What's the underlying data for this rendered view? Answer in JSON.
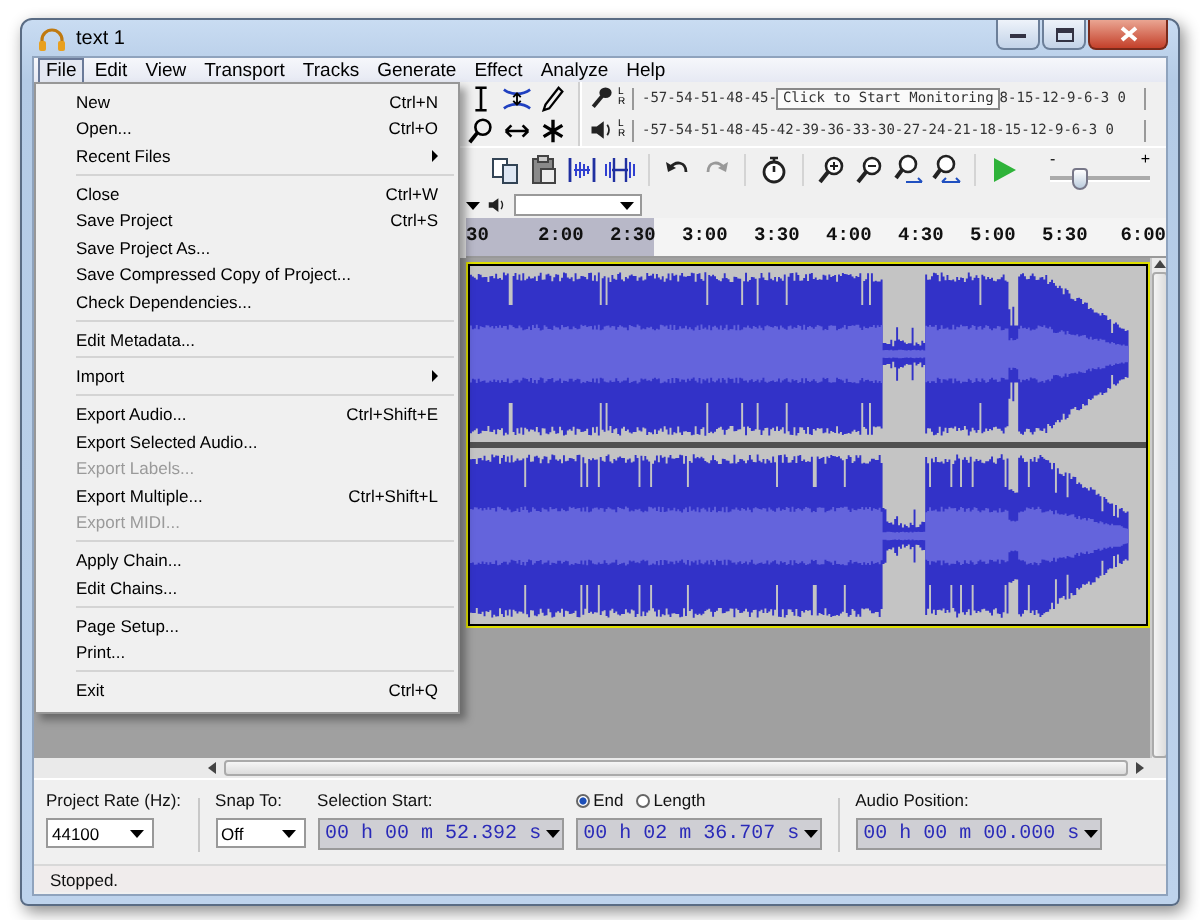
{
  "window": {
    "title": "text 1"
  },
  "menu_bar": [
    {
      "label": "File",
      "selected": true
    },
    {
      "label": "Edit",
      "selected": false
    },
    {
      "label": "View",
      "selected": false
    },
    {
      "label": "Transport",
      "selected": false
    },
    {
      "label": "Tracks",
      "selected": false
    },
    {
      "label": "Generate",
      "selected": false
    },
    {
      "label": "Effect",
      "selected": false
    },
    {
      "label": "Analyze",
      "selected": false
    },
    {
      "label": "Help",
      "selected": false
    }
  ],
  "file_menu": [
    {
      "kind": "item",
      "label": "New",
      "shortcut": "Ctrl+N",
      "disabled": false
    },
    {
      "kind": "item",
      "label": "Open...",
      "shortcut": "Ctrl+O",
      "disabled": false
    },
    {
      "kind": "submenu",
      "label": "Recent Files",
      "disabled": false
    },
    {
      "kind": "separator"
    },
    {
      "kind": "item",
      "label": "Close",
      "shortcut": "Ctrl+W",
      "disabled": false
    },
    {
      "kind": "item",
      "label": "Save Project",
      "shortcut": "Ctrl+S",
      "disabled": false
    },
    {
      "kind": "item",
      "label": "Save Project As...",
      "disabled": false
    },
    {
      "kind": "item",
      "label": "Save Compressed Copy of Project...",
      "disabled": false
    },
    {
      "kind": "item",
      "label": "Check Dependencies...",
      "disabled": false
    },
    {
      "kind": "separator"
    },
    {
      "kind": "item",
      "label": "Edit Metadata...",
      "disabled": false
    },
    {
      "kind": "separator"
    },
    {
      "kind": "submenu",
      "label": "Import",
      "disabled": false
    },
    {
      "kind": "separator"
    },
    {
      "kind": "item",
      "label": "Export Audio...",
      "shortcut": "Ctrl+Shift+E",
      "disabled": false
    },
    {
      "kind": "item",
      "label": "Export Selected Audio...",
      "disabled": false
    },
    {
      "kind": "item",
      "label": "Export Labels...",
      "disabled": true
    },
    {
      "kind": "item",
      "label": "Export Multiple...",
      "shortcut": "Ctrl+Shift+L",
      "disabled": false
    },
    {
      "kind": "item",
      "label": "Export MIDI...",
      "disabled": true
    },
    {
      "kind": "separator"
    },
    {
      "kind": "item",
      "label": "Apply Chain...",
      "disabled": false
    },
    {
      "kind": "item",
      "label": "Edit Chains...",
      "disabled": false
    },
    {
      "kind": "separator"
    },
    {
      "kind": "item",
      "label": "Page Setup...",
      "disabled": false
    },
    {
      "kind": "item",
      "label": "Print...",
      "disabled": false
    },
    {
      "kind": "separator"
    },
    {
      "kind": "item",
      "label": "Exit",
      "shortcut": "Ctrl+Q",
      "disabled": false
    }
  ],
  "meters": {
    "record": {
      "channel_labels": [
        "L",
        "R"
      ],
      "scale_start": "-57-54-51-48-45-",
      "prompt": "Click to Start Monitoring",
      "scale_end": "8-15-12-9-6-3 0"
    },
    "playback": {
      "channel_labels": [
        "L",
        "R"
      ],
      "scale": "-57-54-51-48-45-42-39-36-33-30-27-24-21-18-15-12-9-6-3 0"
    }
  },
  "play_speed": {
    "min_label": "-",
    "max_label": "+",
    "level": 0.3
  },
  "ruler": {
    "labels": [
      "30",
      "2:00",
      "2:30",
      "3:00",
      "3:30",
      "4:00",
      "4:30",
      "5:00",
      "5:30",
      "6:00"
    ]
  },
  "selection_bar": {
    "project_rate": {
      "label": "Project Rate (Hz):",
      "value": "44100"
    },
    "snap_to": {
      "label": "Snap To:",
      "value": "Off"
    },
    "selection_start": {
      "label": "Selection Start:",
      "value": "00 h 00 m 52.392 s"
    },
    "end_mode": [
      {
        "label": "End",
        "selected": true
      },
      {
        "label": "Length",
        "selected": false
      }
    ],
    "selection_end": {
      "value": "00 h 02 m 36.707 s"
    },
    "audio_position": {
      "label": "Audio Position:",
      "value": "00 h 00 m 00.000 s"
    }
  },
  "status_bar": {
    "text": "Stopped."
  }
}
